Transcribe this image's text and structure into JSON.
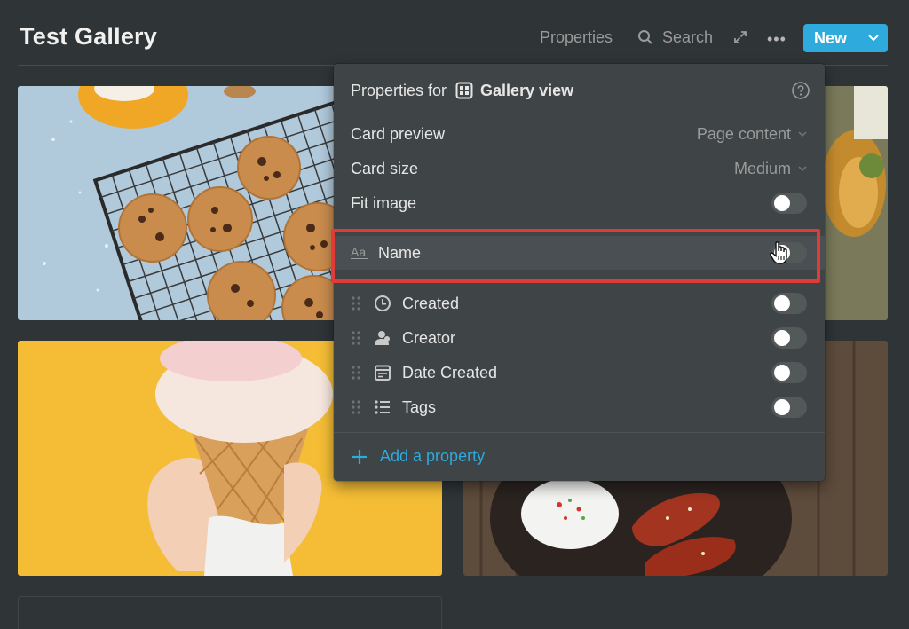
{
  "header": {
    "title": "Test Gallery",
    "properties_label": "Properties",
    "search_label": "Search",
    "new_label": "New"
  },
  "popup": {
    "title_prefix": "Properties for",
    "view_name": "Gallery view",
    "card_preview_label": "Card preview",
    "card_preview_value": "Page content",
    "card_size_label": "Card size",
    "card_size_value": "Medium",
    "fit_image_label": "Fit image",
    "fit_image_on": false,
    "properties": [
      {
        "label": "Name",
        "icon": "text-aa-icon",
        "on": false
      },
      {
        "label": "Created",
        "icon": "clock-icon",
        "on": false
      },
      {
        "label": "Creator",
        "icon": "person-icon",
        "on": false
      },
      {
        "label": "Date Created",
        "icon": "calendar-icon",
        "on": false
      },
      {
        "label": "Tags",
        "icon": "list-icon",
        "on": false
      }
    ],
    "add_property_label": "Add a property"
  },
  "colors": {
    "background": "#2f3437",
    "popup": "#3f4447",
    "accent": "#2eaadc",
    "highlight": "#e03b37"
  }
}
